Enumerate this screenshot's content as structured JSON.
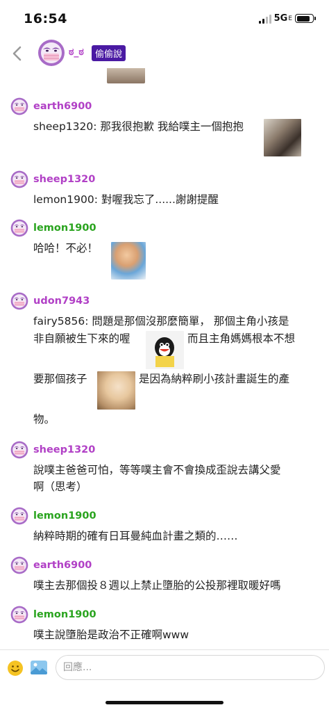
{
  "status_bar": {
    "time": "16:54",
    "network": "5G",
    "network_suffix": "E",
    "battery_level": 0.85
  },
  "header": {
    "back_icon": "chevron-left-icon",
    "name": "ಠ_ಠ",
    "badge": "偷偷說"
  },
  "messages": [
    {
      "user": "earth6900",
      "color": "#b140c6",
      "text": "sheep1320: 那我很抱歉 我給噗主一個抱抱"
    },
    {
      "user": "sheep1320",
      "color": "#b140c6",
      "text": "lemon1900: 對喔我忘了......謝謝提醒"
    },
    {
      "user": "lemon1900",
      "color": "#2aa41f",
      "text": "哈哈！不必！"
    },
    {
      "user": "udon7943",
      "color": "#b140c6",
      "lines": [
        "fairy5856: 問題是那個沒那麼簡單，  那個主角小孩是",
        "非自願被生下來的喔",
        "而且主角媽媽根本不想",
        "要那個孩子",
        "是因為納粹刷小孩計畫誕生的產",
        "物。"
      ]
    },
    {
      "user": "sheep1320",
      "color": "#b140c6",
      "lines": [
        "說噗主爸爸可怕，等等噗主會不會換成歪說去講父愛",
        "啊（思考）"
      ]
    },
    {
      "user": "lemon1900",
      "color": "#2aa41f",
      "text": "納粹時期的確有日耳曼純血計畫之類的……"
    },
    {
      "user": "earth6900",
      "color": "#b140c6",
      "text": "噗主去那個投８週以上禁止墮胎的公投那裡取暖好嗎"
    },
    {
      "user": "lemon1900",
      "color": "#2aa41f",
      "text": "噗主說墮胎是政治不正確啊www"
    }
  ],
  "input": {
    "placeholder": "回應...",
    "emoji_icon": "smiley-icon",
    "image_icon": "image-icon"
  }
}
